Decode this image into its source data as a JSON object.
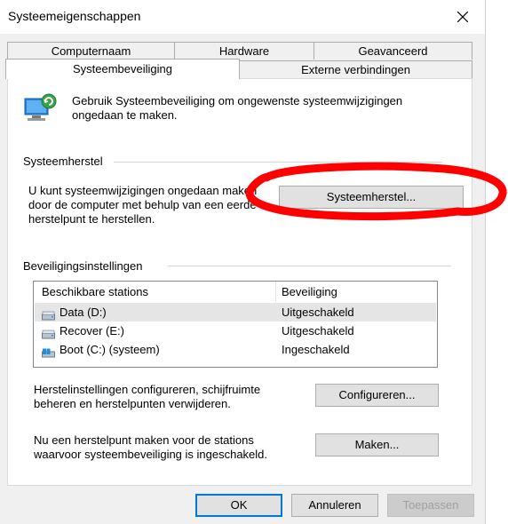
{
  "window": {
    "title": "Systeemeigenschappen"
  },
  "tabs": [
    {
      "label": "Computernaam"
    },
    {
      "label": "Hardware"
    },
    {
      "label": "Geavanceerd"
    },
    {
      "label": "Systeembeveiliging"
    },
    {
      "label": "Externe verbindingen"
    }
  ],
  "intro": {
    "text_line1": "Gebruik Systeembeveiliging om ongewenste systeemwijzigingen",
    "text_line2": "ongedaan te maken."
  },
  "restore": {
    "group_label": "Systeemherstel",
    "desc_line1": "U kunt systeemwijzigingen ongedaan maken",
    "desc_line2": "door de computer met behulp van een eerde",
    "desc_line3": "herstelpunt te herstellen.",
    "button_label": "Systeemherstel..."
  },
  "protection": {
    "group_label": "Beveiligingsinstellingen",
    "columns": {
      "drive": "Beschikbare stations",
      "status": "Beveiliging"
    },
    "rows": [
      {
        "drive": "Data (D:)",
        "status": "Uitgeschakeld"
      },
      {
        "drive": "Recover (E:)",
        "status": "Uitgeschakeld"
      },
      {
        "drive": "Boot (C:) (systeem)",
        "status": "Ingeschakeld"
      }
    ],
    "configure_text_line1": "Herstelinstellingen configureren, schijfruimte",
    "configure_text_line2": "beheren en herstelpunten verwijderen.",
    "configure_button": "Configureren...",
    "create_text_line1": "Nu een herstelpunt maken voor de stations",
    "create_text_line2": "waarvoor systeembeveiliging is ingeschakeld.",
    "create_button": "Maken..."
  },
  "footer": {
    "ok": "OK",
    "cancel": "Annuleren",
    "apply": "Toepassen"
  },
  "colors": {
    "annotation": "#ff0000",
    "accent": "#0078d7"
  }
}
